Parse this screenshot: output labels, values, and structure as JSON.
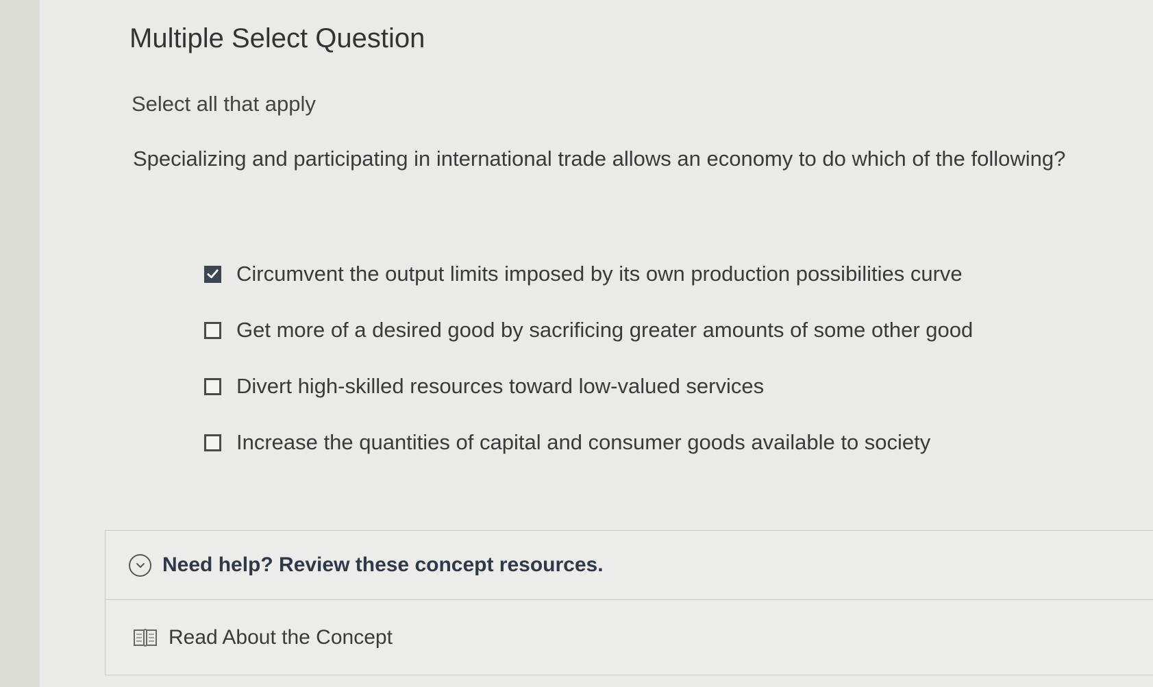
{
  "question": {
    "title": "Multiple Select Question",
    "instruction": "Select all that apply",
    "prompt": "Specializing and participating in international trade allows an economy to do which of the following?"
  },
  "options": [
    {
      "label": "Circumvent the output limits imposed by its own production possibilities curve",
      "checked": true
    },
    {
      "label": "Get more of a desired good by sacrificing greater amounts of some other good",
      "checked": false
    },
    {
      "label": "Divert high-skilled resources toward low-valued services",
      "checked": false
    },
    {
      "label": "Increase the quantities of capital and consumer goods available to society",
      "checked": false
    }
  ],
  "help": {
    "title": "Need help? Review these concept resources.",
    "link_label": "Read About the Concept",
    "chevron_icon": "chevron-down-circle-icon",
    "link_icon": "book-icon"
  },
  "colors": {
    "checked_fill": "#3d4550",
    "help_title": "#2f3a48"
  }
}
